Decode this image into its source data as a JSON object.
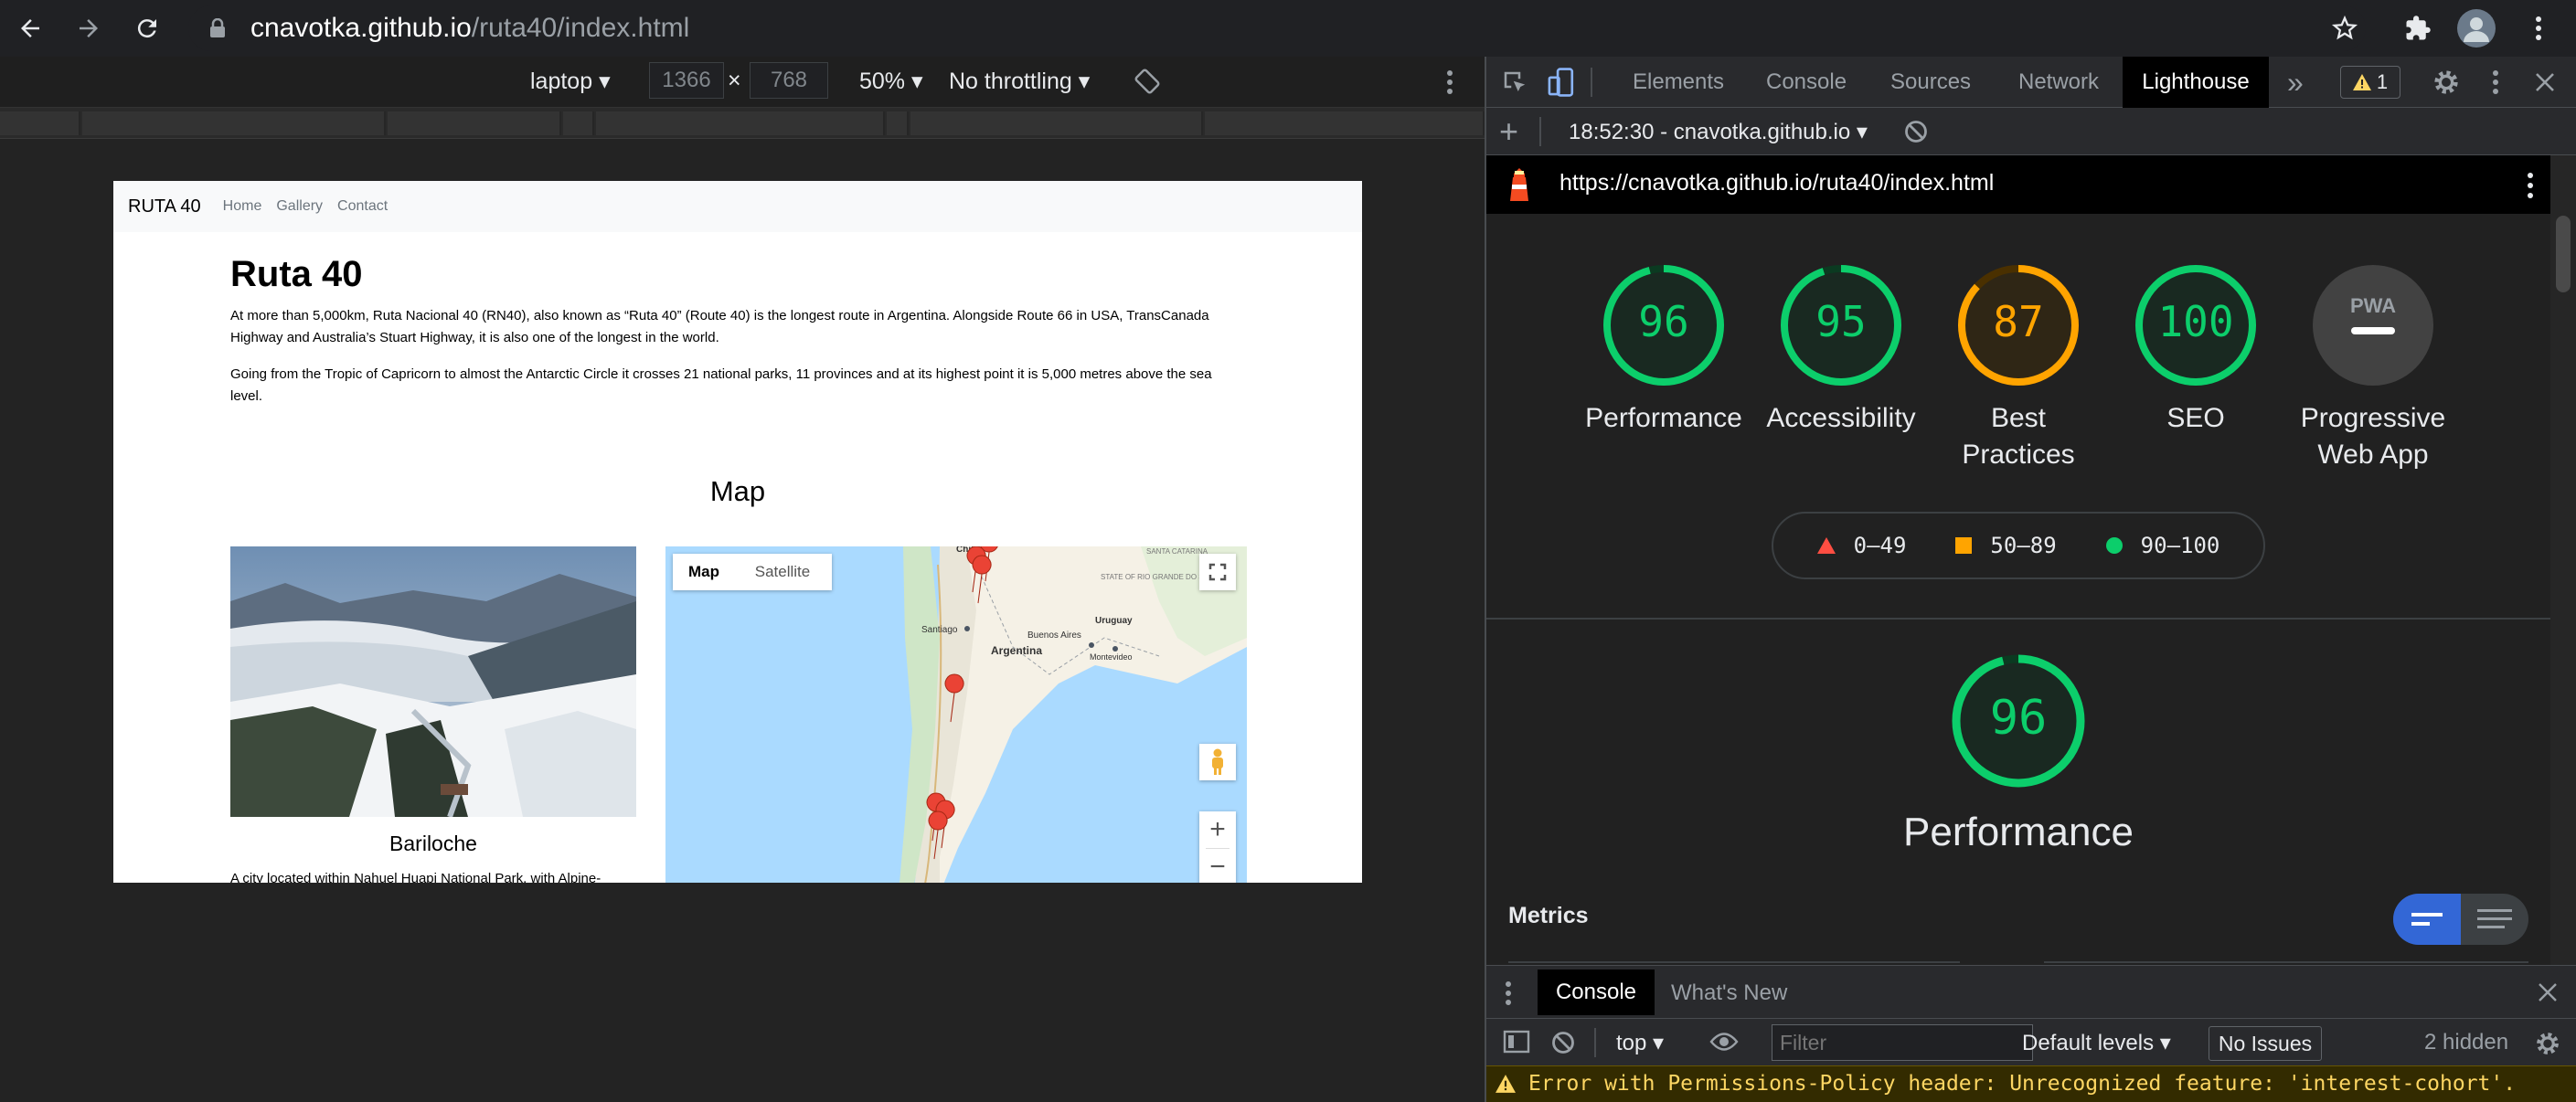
{
  "browser": {
    "url_host": "cnavotka.github.io",
    "url_path": "/ruta40/index.html"
  },
  "device_toolbar": {
    "device": "laptop",
    "width": "1366",
    "height": "768",
    "times": "×",
    "zoom": "50%",
    "throttling": "No throttling"
  },
  "site": {
    "brand": "RUTA 40",
    "nav": [
      "Home",
      "Gallery",
      "Contact"
    ],
    "title": "Ruta 40",
    "paragraph1": "At more than 5,000km, Ruta Nacional 40 (RN40), also known as “Ruta 40” (Route 40) is the longest route in Argentina. Alongside Route 66 in USA, TransCanada Highway and Australia’s Stuart Highway, it is also one of the longest in the world.",
    "paragraph2": "Going from the Tropic of Capricorn to almost the Antarctic Circle it crosses 21 national parks, 11 provinces and at its highest point it is 5,000 metres above the sea level.",
    "map_heading": "Map",
    "photo_caption": "Bariloche",
    "photo_text": "A city located within Nahuel Huapi National Park, with Alpine-",
    "map": {
      "tab_map": "Map",
      "tab_satellite": "Satellite",
      "labels": {
        "chile": "Chile",
        "santiago": "Santiago",
        "argentina": "Argentina",
        "buenos_aires": "Buenos Aires",
        "uruguay": "Uruguay",
        "montevideo": "Montevideo",
        "santa_catarina": "SANTA CATARINA",
        "rio_grande": "STATE OF RIO GRANDE DO SUL"
      },
      "zoom_in": "+",
      "zoom_out": "−"
    }
  },
  "devtools": {
    "tabs": [
      "Elements",
      "Console",
      "Sources",
      "Network",
      "Lighthouse"
    ],
    "active_tab": "Lighthouse",
    "more": "»",
    "warning_count": "1",
    "report_label": "18:52:30 - cnavotka.github.io",
    "add": "+",
    "report_url": "https://cnavotka.github.io/ruta40/index.html",
    "scores": [
      {
        "value": "96",
        "label": "Performance",
        "score": 96,
        "color": "#0cce6b"
      },
      {
        "value": "95",
        "label": "Accessibility",
        "score": 95,
        "color": "#0cce6b"
      },
      {
        "value": "87",
        "label": "Best Practices",
        "score": 87,
        "color": "#ffa400"
      },
      {
        "value": "100",
        "label": "SEO",
        "score": 100,
        "color": "#0cce6b"
      },
      {
        "value": "PWA",
        "label": "Progressive Web App",
        "color": "#9aa0a6"
      }
    ],
    "legend": [
      "0–49",
      "50–89",
      "90–100"
    ],
    "legend_colors": {
      "fail": "#ff4e42",
      "average": "#ffa400",
      "pass": "#0cce6b"
    },
    "big_score": {
      "value": "96",
      "label": "Performance",
      "score": 96
    },
    "metrics_label": "Metrics",
    "drawer_tabs": [
      "Console",
      "What's New"
    ],
    "drawer": {
      "context": "top",
      "filter_placeholder": "Filter",
      "levels": "Default levels",
      "issues": "No Issues",
      "hidden": "2 hidden"
    },
    "error_message": "Error with Permissions-Policy header: Unrecognized feature: 'interest-cohort'."
  }
}
